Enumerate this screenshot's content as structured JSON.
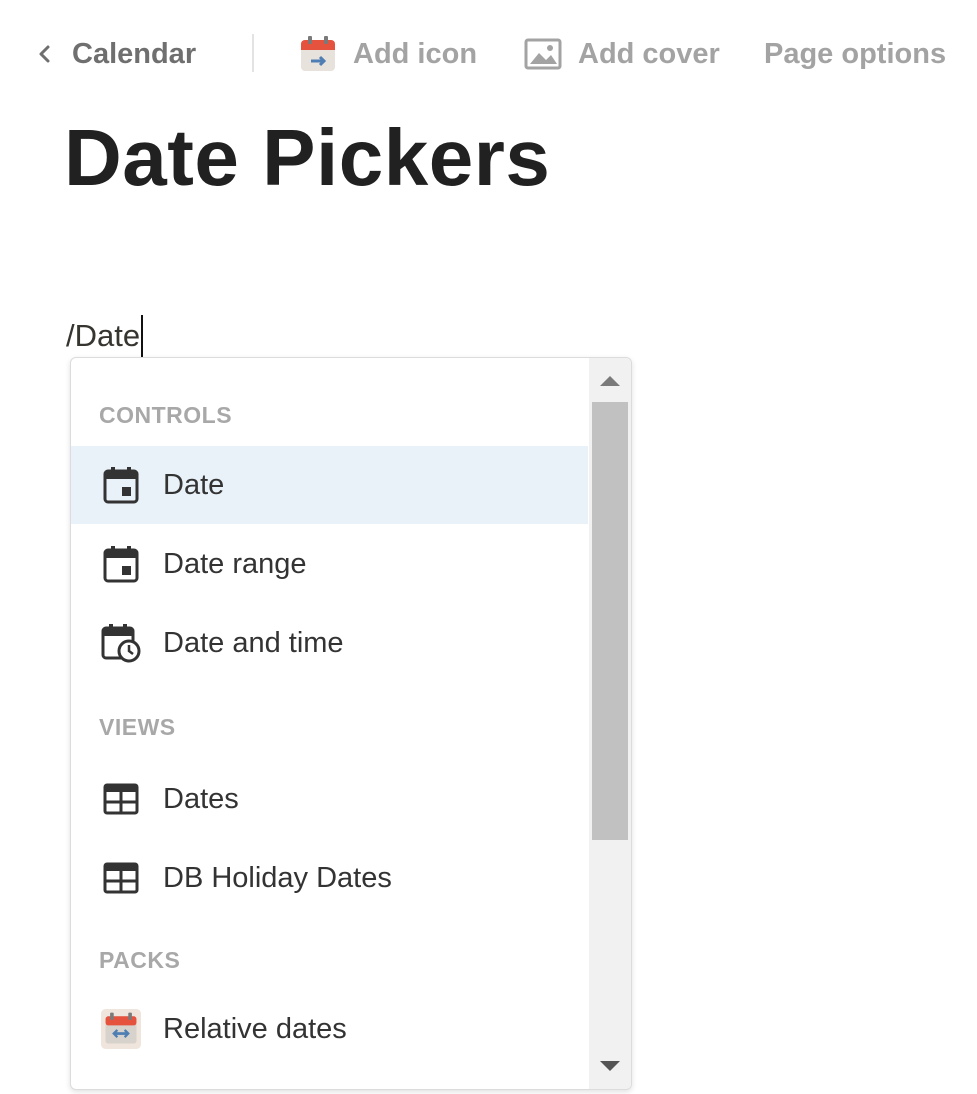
{
  "topbar": {
    "back_label": "Calendar",
    "add_icon_label": "Add icon",
    "add_cover_label": "Add cover",
    "page_options_label": "Page options"
  },
  "page": {
    "title": "Date Pickers"
  },
  "editor": {
    "text": "/Date"
  },
  "menu": {
    "sections": [
      {
        "label": "CONTROLS"
      },
      {
        "label": "VIEWS"
      },
      {
        "label": "PACKS"
      }
    ],
    "items": [
      {
        "label": "Date",
        "icon": "calendar-icon",
        "selected": true
      },
      {
        "label": "Date range",
        "icon": "calendar-icon"
      },
      {
        "label": "Date and time",
        "icon": "calendar-clock-icon"
      },
      {
        "label": "Dates",
        "icon": "table-icon"
      },
      {
        "label": "DB Holiday Dates",
        "icon": "table-icon"
      },
      {
        "label": "Relative dates",
        "icon": "relative-dates-pack-icon"
      }
    ]
  },
  "colors": {
    "selected_row": "#e8f2f8",
    "section_label": "#a8a8a8",
    "title": "#212121"
  }
}
